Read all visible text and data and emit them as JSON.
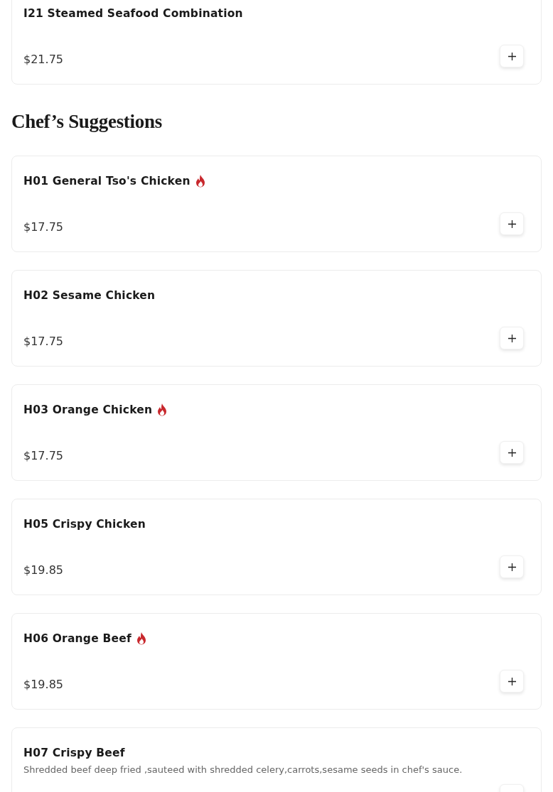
{
  "sections": [
    {
      "items": [
        {
          "name": "I21 Steamed Seafood Combination",
          "spicy": false,
          "price": "$21.75"
        }
      ]
    },
    {
      "title": "Chef’s Suggestions",
      "items": [
        {
          "name": "H01 General Tso's Chicken",
          "spicy": true,
          "price": "$17.75"
        },
        {
          "name": "H02 Sesame Chicken",
          "spicy": false,
          "price": "$17.75"
        },
        {
          "name": "H03 Orange Chicken",
          "spicy": true,
          "price": "$17.75"
        },
        {
          "name": "H05 Crispy Chicken",
          "spicy": false,
          "price": "$19.85"
        },
        {
          "name": "H06 Orange Beef",
          "spicy": true,
          "price": "$19.85"
        },
        {
          "name": "H07 Crispy Beef",
          "spicy": false,
          "description": "Shredded beef deep fried ,sauteed with shredded celery,carrots,sesame seeds in chef's sauce."
        }
      ]
    }
  ]
}
